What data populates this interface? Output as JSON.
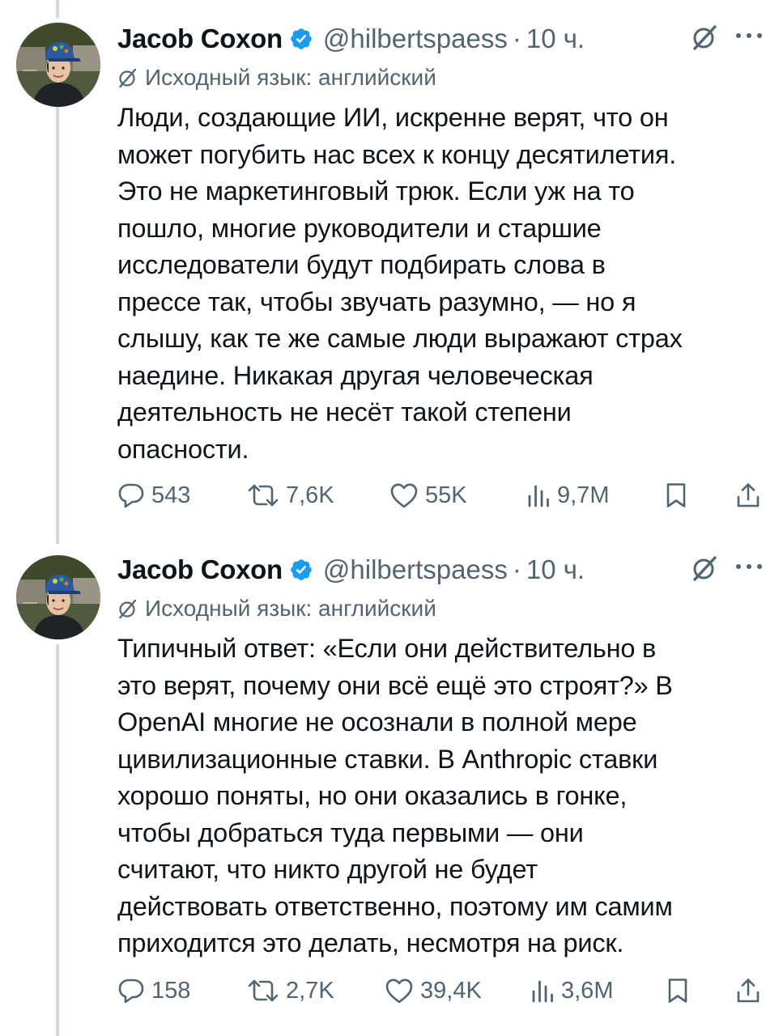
{
  "tweets": [
    {
      "author_name": "Jacob Coxon",
      "handle": "@hilbertspaess",
      "separator": "·",
      "time": "10 ч.",
      "translated_from": "Исходный язык: английский",
      "text": "Люди, создающие ИИ, искренне верят, что он\nможет погубить нас всех к концу десятилетия.\nЭто не маркетинговый трюк. Если уж на то\nпошло, многие руководители и старшие\nисследователи будут подбирать слова в\nпрессе так, чтобы звучать разумно, — но я\nслышу, как те же самые люди выражают страх\nнаедине. Никакая другая человеческая\nдеятельность не несёт такой степени\nопасности.",
      "stats": {
        "replies": "543",
        "reposts": "7,6K",
        "likes": "55K",
        "views": "9,7M"
      }
    },
    {
      "author_name": "Jacob Coxon",
      "handle": "@hilbertspaess",
      "separator": "·",
      "time": "10 ч.",
      "translated_from": "Исходный язык: английский",
      "text": "Типичный ответ: «Если они действительно в\nэто верят, почему они всё ещё это строят?» В\nOpenAI многие не осознали в полной мере\nцивилизационные ставки. В Anthropic ставки\nхорошо поняты, но они оказались в гонке,\nчтобы добраться туда первыми — они\nсчитают, что никто другой не будет\nдействовать ответственно, поэтому им самим\nприходится это делать, несмотря на риск.",
      "stats": {
        "replies": "158",
        "reposts": "2,7K",
        "likes": "39,4K",
        "views": "3,6M"
      }
    }
  ],
  "colors": {
    "text": "#0f1419",
    "secondary": "#536471",
    "verified": "#1d9bf0",
    "thread_line": "#cfd9de"
  },
  "icons": [
    "verified-badge-icon",
    "grok-icon",
    "more-icon",
    "translate-icon",
    "reply-icon",
    "repost-icon",
    "like-icon",
    "views-icon",
    "bookmark-icon",
    "share-icon"
  ]
}
